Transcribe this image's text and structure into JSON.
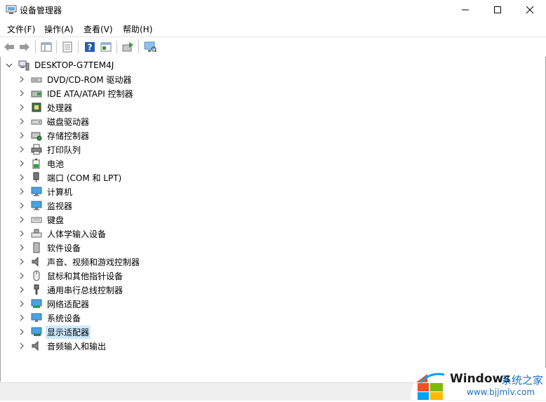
{
  "window": {
    "title": "设备管理器"
  },
  "menubar": {
    "file": "文件(F)",
    "action": "操作(A)",
    "view": "查看(V)",
    "help": "帮助(H)"
  },
  "tree": {
    "root": "DESKTOP-G7TEM4J",
    "items": [
      {
        "label": "DVD/CD-ROM 驱动器",
        "icon": "dvd-drive-icon"
      },
      {
        "label": "IDE ATA/ATAPI 控制器",
        "icon": "ide-controller-icon"
      },
      {
        "label": "处理器",
        "icon": "processor-icon"
      },
      {
        "label": "磁盘驱动器",
        "icon": "disk-drive-icon"
      },
      {
        "label": "存储控制器",
        "icon": "storage-controller-icon"
      },
      {
        "label": "打印队列",
        "icon": "printer-icon"
      },
      {
        "label": "电池",
        "icon": "battery-icon"
      },
      {
        "label": "端口 (COM 和 LPT)",
        "icon": "port-icon"
      },
      {
        "label": "计算机",
        "icon": "computer-icon"
      },
      {
        "label": "监视器",
        "icon": "monitor-icon"
      },
      {
        "label": "键盘",
        "icon": "keyboard-icon"
      },
      {
        "label": "人体学输入设备",
        "icon": "hid-icon"
      },
      {
        "label": "软件设备",
        "icon": "software-device-icon"
      },
      {
        "label": "声音、视频和游戏控制器",
        "icon": "sound-icon"
      },
      {
        "label": "鼠标和其他指针设备",
        "icon": "mouse-icon"
      },
      {
        "label": "通用串行总线控制器",
        "icon": "usb-icon"
      },
      {
        "label": "网络适配器",
        "icon": "network-adapter-icon"
      },
      {
        "label": "系统设备",
        "icon": "system-device-icon"
      },
      {
        "label": "显示适配器",
        "icon": "display-adapter-icon",
        "selected": true
      },
      {
        "label": "音频输入和输出",
        "icon": "audio-io-icon"
      }
    ]
  },
  "watermark": {
    "brand": "Windows",
    "site_name": "系统之家",
    "url": "www.bjjmlv.com"
  },
  "colors": {
    "selection": "#cce8ff",
    "accent": "#0078d7"
  }
}
